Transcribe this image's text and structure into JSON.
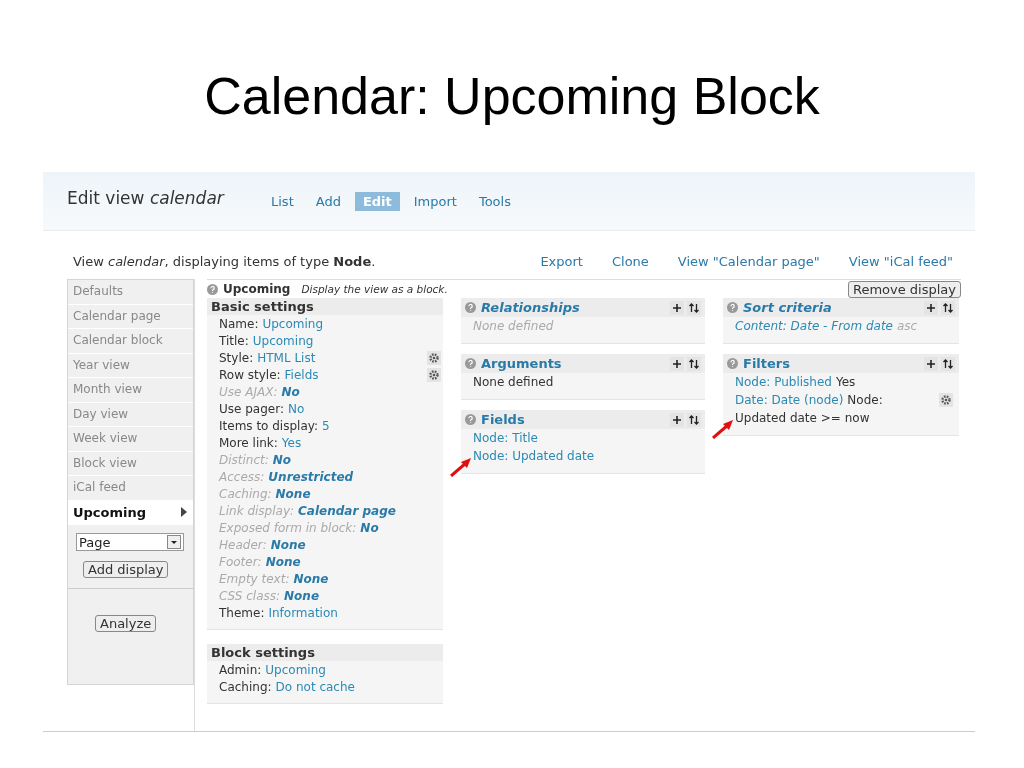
{
  "slide_title": "Calendar: Upcoming Block",
  "header": {
    "title": "Edit view *calendar*",
    "tabs": [
      {
        "label": "List",
        "selected": false
      },
      {
        "label": "Add",
        "selected": false
      },
      {
        "label": "Edit",
        "selected": true
      },
      {
        "label": "Import",
        "selected": false
      },
      {
        "label": "Tools",
        "selected": false
      }
    ]
  },
  "info": {
    "text": "View *calendar*, displaying items of type **Node**.",
    "links": [
      "Export",
      "Clone",
      "View \"Calendar page\"",
      "View \"iCal feed\""
    ]
  },
  "sidebar": {
    "items": [
      {
        "label": "Defaults",
        "selected": false
      },
      {
        "label": "Calendar page",
        "selected": false
      },
      {
        "label": "Calendar block",
        "selected": false
      },
      {
        "label": "Year view",
        "selected": false
      },
      {
        "label": "Month view",
        "selected": false
      },
      {
        "label": "Day view",
        "selected": false
      },
      {
        "label": "Week view",
        "selected": false
      },
      {
        "label": "Block view",
        "selected": false
      },
      {
        "label": "iCal feed",
        "selected": false
      },
      {
        "label": "Upcoming",
        "selected": true
      }
    ],
    "display_type": {
      "value": "Page"
    },
    "add_button": "Add display",
    "analyze_button": "Analyze"
  },
  "display": {
    "name": "Upcoming",
    "description": "Display the view as a block.",
    "remove_button": "Remove display"
  },
  "basic_settings": {
    "title": "Basic settings",
    "items": [
      {
        "label": "Name:",
        "value": "Upcoming",
        "inherited": false,
        "gear": false
      },
      {
        "label": "Title:",
        "value": "Upcoming",
        "inherited": false,
        "gear": false
      },
      {
        "label": "Style:",
        "value": "HTML List",
        "inherited": false,
        "gear": true
      },
      {
        "label": "Row style:",
        "value": "Fields",
        "inherited": false,
        "gear": true
      },
      {
        "label": "Use AJAX:",
        "value": "No",
        "inherited": true,
        "gear": false
      },
      {
        "label": "Use pager:",
        "value": "No",
        "inherited": false,
        "gear": false
      },
      {
        "label": "Items to display:",
        "value": "5",
        "inherited": false,
        "gear": false
      },
      {
        "label": "More link:",
        "value": "Yes",
        "inherited": false,
        "gear": false
      },
      {
        "label": "Distinct:",
        "value": "No",
        "inherited": true,
        "gear": false
      },
      {
        "label": "Access:",
        "value": "Unrestricted",
        "inherited": true,
        "gear": false
      },
      {
        "label": "Caching:",
        "value": "None",
        "inherited": true,
        "gear": false
      },
      {
        "label": "Link display:",
        "value": "Calendar page",
        "inherited": true,
        "gear": false
      },
      {
        "label": "Exposed form in block:",
        "value": "No",
        "inherited": true,
        "gear": false
      },
      {
        "label": "Header:",
        "value": "None",
        "inherited": true,
        "gear": false
      },
      {
        "label": "Footer:",
        "value": "None",
        "inherited": true,
        "gear": false
      },
      {
        "label": "Empty text:",
        "value": "None",
        "inherited": true,
        "gear": false
      },
      {
        "label": "CSS class:",
        "value": "None",
        "inherited": true,
        "gear": false
      },
      {
        "label": "Theme:",
        "value": "Information",
        "inherited": false,
        "gear": false
      }
    ]
  },
  "block_settings": {
    "title": "Block settings",
    "items": [
      {
        "label": "Admin:",
        "value": "Upcoming",
        "inherited": false,
        "gear": false
      },
      {
        "label": "Caching:",
        "value": "Do not cache",
        "inherited": false,
        "gear": false
      }
    ]
  },
  "columns": [
    [
      {
        "title": "Relationships",
        "italic": true,
        "items": [
          {
            "italic": true,
            "gear": false,
            "highlighted": false,
            "parts": [
              {
                "kind": "muted",
                "text": "None defined"
              }
            ]
          }
        ]
      },
      {
        "title": "Arguments",
        "italic": false,
        "items": [
          {
            "italic": false,
            "gear": false,
            "highlighted": false,
            "parts": [
              {
                "kind": "plain",
                "text": "None defined"
              }
            ]
          }
        ]
      },
      {
        "title": "Fields",
        "italic": false,
        "items": [
          {
            "italic": false,
            "gear": false,
            "highlighted": false,
            "parts": [
              {
                "kind": "link",
                "text": "Node: Title"
              }
            ]
          },
          {
            "italic": false,
            "gear": false,
            "highlighted": true,
            "parts": [
              {
                "kind": "link",
                "text": "Node: Updated date"
              }
            ]
          }
        ]
      }
    ],
    [
      {
        "title": "Sort criteria",
        "italic": true,
        "items": [
          {
            "italic": true,
            "gear": false,
            "highlighted": false,
            "parts": [
              {
                "kind": "link",
                "text": "Content: Date - From date"
              },
              {
                "kind": "muted",
                "text": "asc"
              }
            ]
          }
        ]
      },
      {
        "title": "Filters",
        "italic": false,
        "items": [
          {
            "italic": false,
            "gear": false,
            "highlighted": false,
            "parts": [
              {
                "kind": "link",
                "text": "Node: Published"
              },
              {
                "kind": "plain",
                "text": "Yes"
              }
            ]
          },
          {
            "italic": false,
            "gear": true,
            "highlighted": false,
            "parts": [
              {
                "kind": "link",
                "text": "Date: Date (node)"
              },
              {
                "kind": "plain",
                "text": "Node:"
              }
            ]
          },
          {
            "italic": false,
            "gear": false,
            "highlighted": true,
            "parts": [
              {
                "kind": "plain",
                "text": "Updated date >= now"
              }
            ]
          }
        ]
      }
    ]
  ]
}
